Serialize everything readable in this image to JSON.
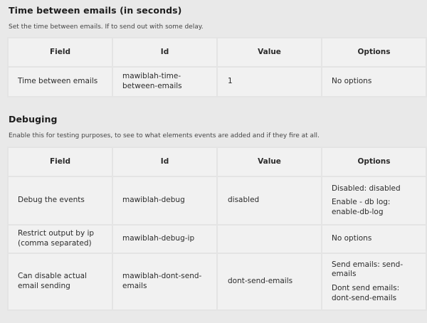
{
  "section1": {
    "title": "Time between emails (in seconds)",
    "description": "Set the time between emails. If to send out with some delay.",
    "headers": [
      "Field",
      "Id",
      "Value",
      "Options"
    ],
    "rows": [
      {
        "field": "Time between emails",
        "id": "mawiblah-time-between-emails",
        "value": "1",
        "options": [
          "No options"
        ]
      }
    ]
  },
  "section2": {
    "title": "Debuging",
    "description": "Enable this for testing purposes, to see to what elements events are added and if they fire at all.",
    "headers": [
      "Field",
      "Id",
      "Value",
      "Options"
    ],
    "rows": [
      {
        "field": "Debug the events",
        "id": "mawiblah-debug",
        "value": "disabled",
        "options": [
          "Disabled: disabled",
          "Enable - db log: enable-db-log"
        ]
      },
      {
        "field": "Restrict output by ip (comma separated)",
        "id": "mawiblah-debug-ip",
        "value": "",
        "options": [
          "No options"
        ]
      },
      {
        "field": "Can disable actual email sending",
        "id": "mawiblah-dont-send-emails",
        "value": "dont-send-emails",
        "options": [
          "Send emails: send-emails",
          "Dont send emails: dont-send-emails"
        ]
      }
    ]
  }
}
